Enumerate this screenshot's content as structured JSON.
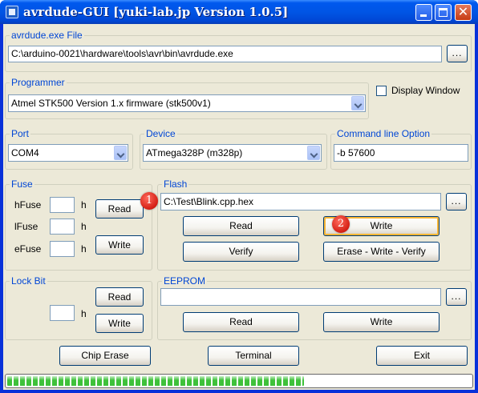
{
  "window": {
    "title": "avrdude-GUI [yuki-lab.jp Version 1.0.5]",
    "close_glyph": "✕"
  },
  "avrdude_file": {
    "title": "avrdude.exe File",
    "path": "C:\\arduino-0021\\hardware\\tools\\avr\\bin\\avrdude.exe",
    "browse_label": "..."
  },
  "programmer": {
    "title": "Programmer",
    "selected": "Atmel STK500 Version 1.x firmware (stk500v1)"
  },
  "display_window": {
    "label": "Display Window",
    "checked": false
  },
  "port": {
    "title": "Port",
    "selected": "COM4"
  },
  "device": {
    "title": "Device",
    "selected": "ATmega328P (m328p)"
  },
  "command_line": {
    "title": "Command line Option",
    "value": "-b 57600"
  },
  "fuse": {
    "title": "Fuse",
    "hfuse_label": "hFuse",
    "lfuse_label": "lFuse",
    "efuse_label": "eFuse",
    "hex_suffix": "h",
    "hfuse_value": "",
    "lfuse_value": "",
    "efuse_value": "",
    "read_label": "Read",
    "write_label": "Write"
  },
  "flash": {
    "title": "Flash",
    "path": "C:\\Test\\Blink.cpp.hex",
    "browse_label": "...",
    "read_label": "Read",
    "write_label": "Write",
    "verify_label": "Verify",
    "erase_write_verify_label": "Erase - Write - Verify"
  },
  "lock_bit": {
    "title": "Lock Bit",
    "hex_suffix": "h",
    "value": "",
    "read_label": "Read",
    "write_label": "Write"
  },
  "eeprom": {
    "title": "EEPROM",
    "path": "",
    "browse_label": "...",
    "read_label": "Read",
    "write_label": "Write"
  },
  "bottom": {
    "chip_erase_label": "Chip Erase",
    "terminal_label": "Terminal",
    "exit_label": "Exit"
  },
  "progress": {
    "fraction": 0.64
  },
  "annotations": {
    "badge_1": "1",
    "badge_2": "2",
    "badge_color": "#d41f14"
  },
  "colors": {
    "group_title": "#0046d5",
    "titlebar": "#0055e5",
    "progress_green": "#3ec13a"
  }
}
